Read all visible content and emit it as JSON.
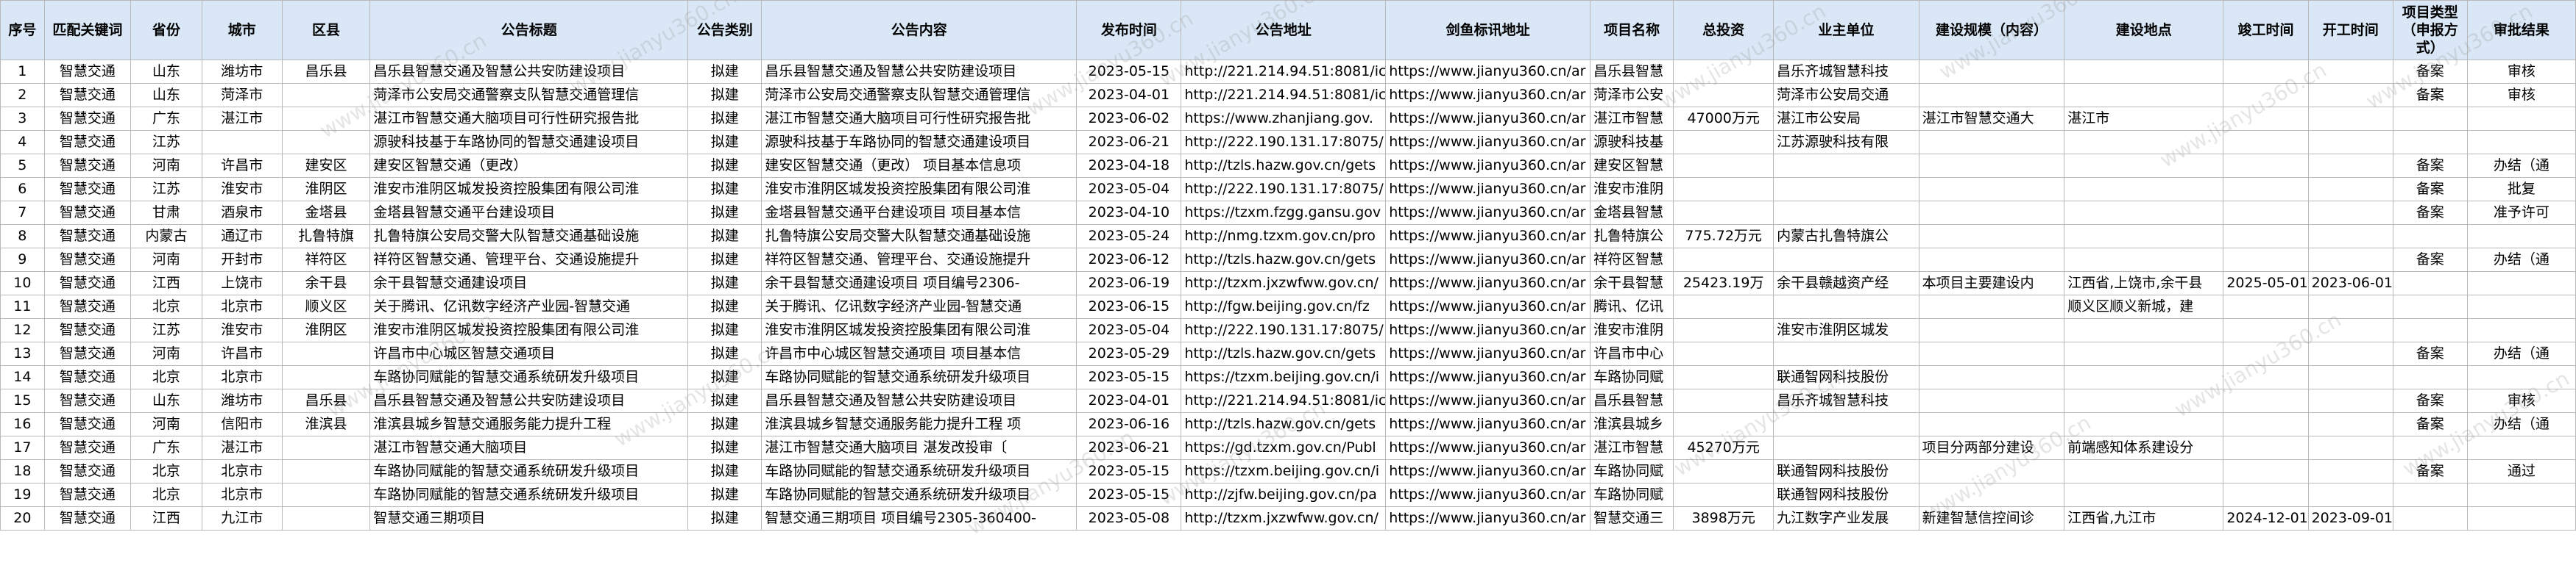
{
  "headers": [
    "序号",
    "匹配关键词",
    "省份",
    "城市",
    "区县",
    "公告标题",
    "公告类别",
    "公告内容",
    "发布时间",
    "公告地址",
    "剑鱼标讯地址",
    "项目名称",
    "总投资",
    "业主单位",
    "建设规模（内容）",
    "建设地点",
    "竣工时间",
    "开工时间",
    "项目类型（申报方式）",
    "审批结果"
  ],
  "watermark": "www.jianyu360.cn",
  "rows": [
    [
      "1",
      "智慧交通",
      "山东",
      "潍坊市",
      "昌乐县",
      "昌乐县智慧交通及智慧公共安防建设项目",
      "拟建",
      "昌乐县智慧交通及智慧公共安防建设项目",
      "2023-05-15",
      "http://221.214.94.51:8081/ici",
      "https://www.jianyu360.cn/ar",
      "昌乐县智慧",
      "",
      "昌乐齐城智慧科技",
      "",
      "",
      "",
      "",
      "备案",
      "审核"
    ],
    [
      "2",
      "智慧交通",
      "山东",
      "菏泽市",
      "",
      "菏泽市公安局交通警察支队智慧交通管理信",
      "拟建",
      "菏泽市公安局交通警察支队智慧交通管理信",
      "2023-04-01",
      "http://221.214.94.51:8081/ici",
      "https://www.jianyu360.cn/ar",
      "菏泽市公安",
      "",
      "菏泽市公安局交通",
      "",
      "",
      "",
      "",
      "备案",
      "审核"
    ],
    [
      "3",
      "智慧交通",
      "广东",
      "湛江市",
      "",
      "湛江市智慧交通大脑项目可行性研究报告批",
      "拟建",
      "湛江市智慧交通大脑项目可行性研究报告批",
      "2023-06-02",
      "https://www.zhanjiang.gov.",
      "https://www.jianyu360.cn/ar",
      "湛江市智慧",
      "47000万元",
      "湛江市公安局",
      "湛江市智慧交通大",
      "湛江市",
      "",
      "",
      "",
      ""
    ],
    [
      "4",
      "智慧交通",
      "江苏",
      "",
      "",
      "源驶科技基于车路协同的智慧交通建设项目",
      "拟建",
      "源驶科技基于车路协同的智慧交通建设项目",
      "2023-06-21",
      "http://222.190.131.17:8075/",
      "https://www.jianyu360.cn/ar",
      "源驶科技基",
      "",
      "江苏源驶科技有限",
      "",
      "",
      "",
      "",
      "",
      ""
    ],
    [
      "5",
      "智慧交通",
      "河南",
      "许昌市",
      "建安区",
      "建安区智慧交通（更改）",
      "拟建",
      "建安区智慧交通（更改） 项目基本信息项",
      "2023-04-18",
      "http://tzls.hazw.gov.cn/gets",
      "https://www.jianyu360.cn/ar",
      "建安区智慧",
      "",
      "",
      "",
      "",
      "",
      "",
      "备案",
      "办结（通"
    ],
    [
      "6",
      "智慧交通",
      "江苏",
      "淮安市",
      "淮阴区",
      "淮安市淮阴区城发投资控股集团有限公司淮",
      "拟建",
      "淮安市淮阴区城发投资控股集团有限公司淮",
      "2023-05-04",
      "http://222.190.131.17:8075/",
      "https://www.jianyu360.cn/ar",
      "淮安市淮阴",
      "",
      "",
      "",
      "",
      "",
      "",
      "备案",
      "批复"
    ],
    [
      "7",
      "智慧交通",
      "甘肃",
      "酒泉市",
      "金塔县",
      "金塔县智慧交通平台建设项目",
      "拟建",
      "金塔县智慧交通平台建设项目 项目基本信",
      "2023-04-10",
      "https://tzxm.fzgg.gansu.gov",
      "https://www.jianyu360.cn/ar",
      "金塔县智慧",
      "",
      "",
      "",
      "",
      "",
      "",
      "备案",
      "准予许可"
    ],
    [
      "8",
      "智慧交通",
      "内蒙古",
      "通辽市",
      "扎鲁特旗",
      "扎鲁特旗公安局交警大队智慧交通基础设施",
      "拟建",
      "扎鲁特旗公安局交警大队智慧交通基础设施",
      "2023-05-24",
      "http://nmg.tzxm.gov.cn/pro",
      "https://www.jianyu360.cn/ar",
      "扎鲁特旗公",
      "775.72万元",
      "内蒙古扎鲁特旗公",
      "",
      "",
      "",
      "",
      "",
      ""
    ],
    [
      "9",
      "智慧交通",
      "河南",
      "开封市",
      "祥符区",
      "祥符区智慧交通、管理平台、交通设施提升",
      "拟建",
      "祥符区智慧交通、管理平台、交通设施提升",
      "2023-06-12",
      "http://tzls.hazw.gov.cn/gets",
      "https://www.jianyu360.cn/ar",
      "祥符区智慧",
      "",
      "",
      "",
      "",
      "",
      "",
      "备案",
      "办结（通"
    ],
    [
      "10",
      "智慧交通",
      "江西",
      "上饶市",
      "余干县",
      "余干县智慧交通建设项目",
      "拟建",
      "余干县智慧交通建设项目 项目编号2306-",
      "2023-06-19",
      "http://tzxm.jxzwfww.gov.cn/",
      "https://www.jianyu360.cn/ar",
      "余干县智慧",
      "25423.19万",
      "余干县赣越资产经",
      "本项目主要建设内",
      "江西省,上饶市,余干县",
      "2025-05-01",
      "2023-06-01",
      "",
      ""
    ],
    [
      "11",
      "智慧交通",
      "北京",
      "北京市",
      "顺义区",
      "关于腾讯、亿讯数字经济产业园-智慧交通",
      "拟建",
      "关于腾讯、亿讯数字经济产业园-智慧交通",
      "2023-06-15",
      "http://fgw.beijing.gov.cn/fz",
      "https://www.jianyu360.cn/ar",
      "腾讯、亿讯",
      "",
      "",
      "",
      "顺义区顺义新城，建",
      "",
      "",
      "",
      ""
    ],
    [
      "12",
      "智慧交通",
      "江苏",
      "淮安市",
      "淮阴区",
      "淮安市淮阴区城发投资控股集团有限公司淮",
      "拟建",
      "淮安市淮阴区城发投资控股集团有限公司淮",
      "2023-05-04",
      "http://222.190.131.17:8075/",
      "https://www.jianyu360.cn/ar",
      "淮安市淮阴",
      "",
      "淮安市淮阴区城发",
      "",
      "",
      "",
      "",
      "",
      ""
    ],
    [
      "13",
      "智慧交通",
      "河南",
      "许昌市",
      "",
      "许昌市中心城区智慧交通项目",
      "拟建",
      "许昌市中心城区智慧交通项目 项目基本信",
      "2023-05-29",
      "http://tzls.hazw.gov.cn/gets",
      "https://www.jianyu360.cn/ar",
      "许昌市中心",
      "",
      "",
      "",
      "",
      "",
      "",
      "备案",
      "办结（通"
    ],
    [
      "14",
      "智慧交通",
      "北京",
      "北京市",
      "",
      "车路协同赋能的智慧交通系统研发升级项目",
      "拟建",
      "车路协同赋能的智慧交通系统研发升级项目",
      "2023-05-15",
      "https://tzxm.beijing.gov.cn/i",
      "https://www.jianyu360.cn/ar",
      "车路协同赋",
      "",
      "联通智网科技股份",
      "",
      "",
      "",
      "",
      "",
      ""
    ],
    [
      "15",
      "智慧交通",
      "山东",
      "潍坊市",
      "昌乐县",
      "昌乐县智慧交通及智慧公共安防建设项目",
      "拟建",
      "昌乐县智慧交通及智慧公共安防建设项目",
      "2023-04-01",
      "http://221.214.94.51:8081/ici",
      "https://www.jianyu360.cn/ar",
      "昌乐县智慧",
      "",
      "昌乐齐城智慧科技",
      "",
      "",
      "",
      "",
      "备案",
      "审核"
    ],
    [
      "16",
      "智慧交通",
      "河南",
      "信阳市",
      "淮滨县",
      "淮滨县城乡智慧交通服务能力提升工程",
      "拟建",
      "淮滨县城乡智慧交通服务能力提升工程 项",
      "2023-06-16",
      "http://tzls.hazw.gov.cn/gets",
      "https://www.jianyu360.cn/ar",
      "淮滨县城乡",
      "",
      "",
      "",
      "",
      "",
      "",
      "备案",
      "办结（通"
    ],
    [
      "17",
      "智慧交通",
      "广东",
      "湛江市",
      "",
      "湛江市智慧交通大脑项目",
      "拟建",
      "湛江市智慧交通大脑项目 湛发改投审〔",
      "2023-06-21",
      "https://gd.tzxm.gov.cn/Publ",
      "https://www.jianyu360.cn/ar",
      "湛江市智慧",
      "45270万元",
      "",
      "项目分两部分建设",
      "前端感知体系建设分",
      "",
      "",
      "",
      ""
    ],
    [
      "18",
      "智慧交通",
      "北京",
      "北京市",
      "",
      "车路协同赋能的智慧交通系统研发升级项目",
      "拟建",
      "车路协同赋能的智慧交通系统研发升级项目",
      "2023-05-15",
      "https://tzxm.beijing.gov.cn/i",
      "https://www.jianyu360.cn/ar",
      "车路协同赋",
      "",
      "联通智网科技股份",
      "",
      "",
      "",
      "",
      "备案",
      "通过"
    ],
    [
      "19",
      "智慧交通",
      "北京",
      "北京市",
      "",
      "车路协同赋能的智慧交通系统研发升级项目",
      "拟建",
      "车路协同赋能的智慧交通系统研发升级项目",
      "2023-05-15",
      "http://zjfw.beijing.gov.cn/pa",
      "https://www.jianyu360.cn/ar",
      "车路协同赋",
      "",
      "联通智网科技股份",
      "",
      "",
      "",
      "",
      "",
      ""
    ],
    [
      "20",
      "智慧交通",
      "江西",
      "九江市",
      "",
      "智慧交通三期项目",
      "拟建",
      "智慧交通三期项目 项目编号2305-360400-",
      "2023-05-08",
      "http://tzxm.jxzwfww.gov.cn/",
      "https://www.jianyu360.cn/ar",
      "智慧交通三",
      "3898万元",
      "九江数字产业发展",
      "新建智慧信控间诊",
      "江西省,九江市",
      "2024-12-01",
      "2023-09-01",
      "",
      ""
    ]
  ]
}
